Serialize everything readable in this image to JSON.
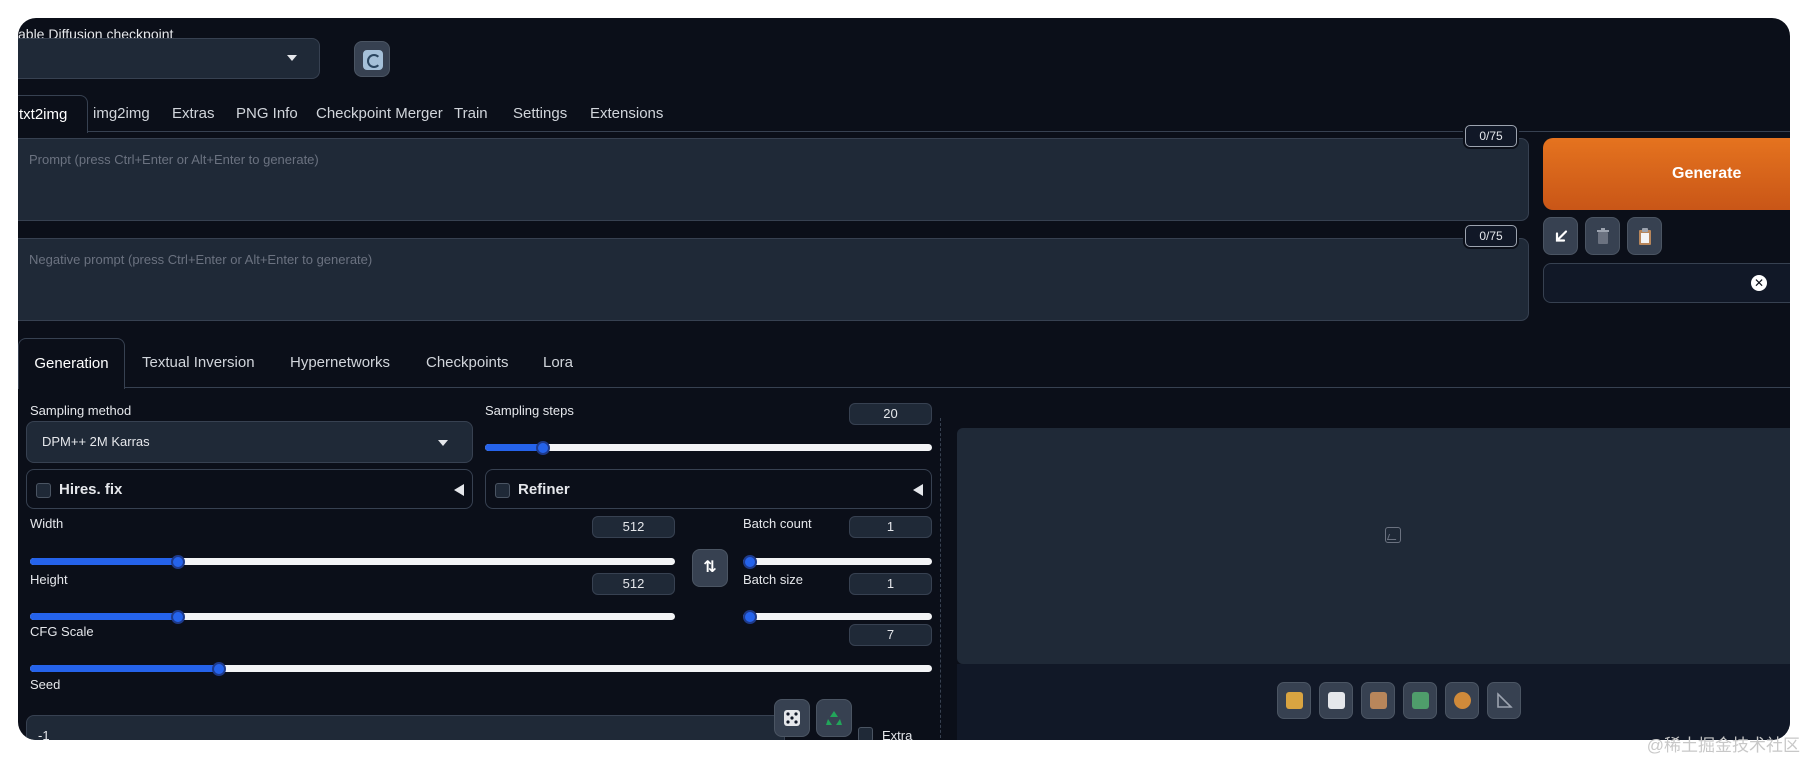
{
  "checkpoint": {
    "label": "able Diffusion checkpoint",
    "selected": ""
  },
  "main_tabs": [
    {
      "label": "txt2img",
      "active": true
    },
    {
      "label": "img2img"
    },
    {
      "label": "Extras"
    },
    {
      "label": "PNG Info"
    },
    {
      "label": "Checkpoint Merger"
    },
    {
      "label": "Train"
    },
    {
      "label": "Settings"
    },
    {
      "label": "Extensions"
    }
  ],
  "prompt": {
    "placeholder": "Prompt (press Ctrl+Enter or Alt+Enter to generate)",
    "token_count": "0/75",
    "value": ""
  },
  "negative_prompt": {
    "placeholder": "Negative prompt (press Ctrl+Enter or Alt+Enter to generate)",
    "token_count": "0/75",
    "value": ""
  },
  "actions": {
    "generate_label": "Generate",
    "tool_icons": [
      "arrow-down-left-icon",
      "trash-icon",
      "clipboard-icon"
    ],
    "styles_value": ""
  },
  "sub_tabs": [
    {
      "label": "Generation",
      "active": true
    },
    {
      "label": "Textual Inversion"
    },
    {
      "label": "Hypernetworks"
    },
    {
      "label": "Checkpoints"
    },
    {
      "label": "Lora"
    }
  ],
  "generation": {
    "sampling_method": {
      "label": "Sampling method",
      "value": "DPM++ 2M Karras"
    },
    "sampling_steps": {
      "label": "Sampling steps",
      "value": "20",
      "fraction": 0.13
    },
    "hires_fix": {
      "label": "Hires. fix",
      "checked": false
    },
    "refiner": {
      "label": "Refiner",
      "checked": false
    },
    "width": {
      "label": "Width",
      "value": "512",
      "fraction": 0.23
    },
    "height": {
      "label": "Height",
      "value": "512",
      "fraction": 0.23
    },
    "batch_count": {
      "label": "Batch count",
      "value": "1",
      "fraction": 0.0
    },
    "batch_size": {
      "label": "Batch size",
      "value": "1",
      "fraction": 0.0
    },
    "cfg_scale": {
      "label": "CFG Scale",
      "value": "7",
      "fraction": 0.21
    },
    "seed": {
      "label": "Seed",
      "value": "-1"
    },
    "extra": {
      "label": "Extra",
      "checked": false
    }
  },
  "output": {
    "buttons": [
      "folder-icon",
      "save-icon",
      "zip-icon",
      "send-to-img2img-icon",
      "send-to-inpaint-icon",
      "send-to-extras-icon"
    ]
  },
  "watermark": "@稀土掘金技术社区",
  "colors": {
    "background": "#0b0f19",
    "panel": "#1f2937",
    "accent": "#2563eb",
    "generate": "#e5731f"
  }
}
